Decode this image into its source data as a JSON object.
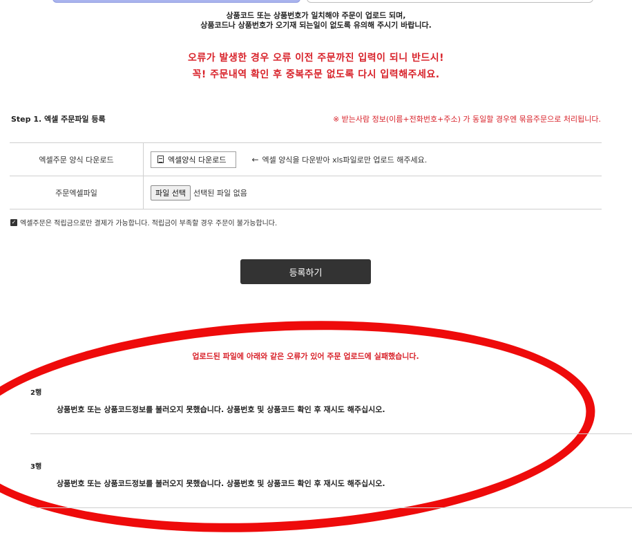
{
  "notices": {
    "line1": "상품코드 또는 상품번호가 일치해야 주문이 업로드 되며,",
    "line2": "상품코드나 상품번호가 오기재 되는일이 없도록 유의해 주시기 바랍니다."
  },
  "warning": {
    "line1": "오류가 발생한 경우 오류 이전 주문까진 입력이 되니 반드시!",
    "line2": "꼭! 주문내역 확인 후 중복주문 없도록 다시 입력해주세요."
  },
  "step": {
    "title": "Step 1. 엑셀 주문파일 등록",
    "note": "※ 받는사람 정보(이름+전화번호+주소) 가 동일할 경우엔 묶음주문으로 처리됩니다."
  },
  "form": {
    "download_label": "엑셀주문 양식 다운로드",
    "download_button": "엑셀양식 다운로드",
    "download_hint": "엑셀 양식을 다운받아 xls파일로만 업로드 해주세요.",
    "file_label": "주문엑셀파일",
    "file_button": "파일 선택",
    "file_status": "선택된 파일 없음"
  },
  "agreement": {
    "text": "엑셀주문은 적립금으로만 결제가 가능합니다. 적립금이 부족할 경우 주문이 불가능합니다."
  },
  "submit_label": "등록하기",
  "errors": {
    "header": "업로드된 파일에 아래와 같은 오류가 있어 주문 업로드에 실패했습니다.",
    "rows": [
      {
        "row": "2행",
        "message": "상품번호 또는 상품코드정보를 불러오지 못했습니다. 상품번호 및 상품코드 확인 후 재시도 해주십시오."
      },
      {
        "row": "3행",
        "message": "상품번호 또는 상품코드정보를 불러오지 못했습니다. 상품번호 및 상품코드 확인 후 재시도 해주십시오."
      }
    ]
  },
  "colors": {
    "warning": "#d8222a",
    "annotation": "#ee0b0b",
    "button_dark": "#333333"
  },
  "icons": {
    "download": "document-icon",
    "hint": "left-arrow-icon",
    "agree": "checkbox-checked-icon"
  }
}
